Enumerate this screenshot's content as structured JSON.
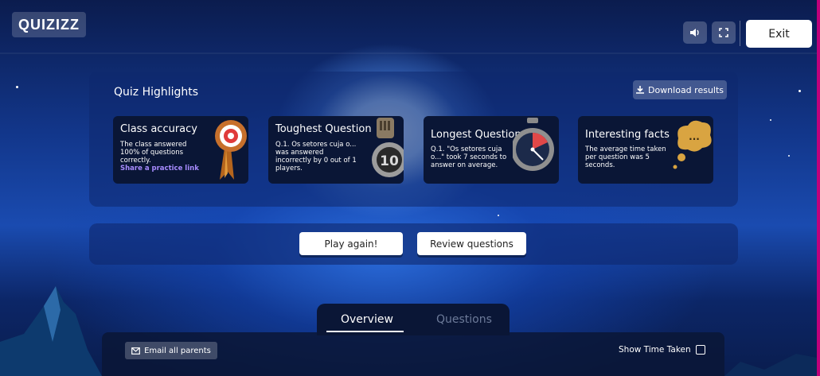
{
  "app": {
    "logo": "QUIZIZZ",
    "exit_label": "Exit"
  },
  "icons": {
    "sound": "speaker-icon",
    "fullscreen": "fullscreen-icon",
    "download": "download-icon",
    "email": "mail-icon"
  },
  "highlights": {
    "title": "Quiz Highlights",
    "download_label": "Download results",
    "cards": [
      {
        "title": "Class accuracy",
        "body": "The class answered 100% of questions correctly.",
        "link": "Share a practice link"
      },
      {
        "title": "Toughest Question",
        "body": "Q.1. Os setores cuja o... was answered incorrectly by 0 out of 1 players.",
        "badge": "10"
      },
      {
        "title": "Longest Question",
        "body": "Q.1. \"Os setores cuja o...\" took 7 seconds to answer on average."
      },
      {
        "title": "Interesting facts",
        "body": "The average time taken per question was 5 seconds.",
        "bubble": "..."
      }
    ]
  },
  "actions": {
    "play_again": "Play again!",
    "review": "Review questions"
  },
  "tabs": {
    "overview": "Overview",
    "questions": "Questions"
  },
  "bottom": {
    "email_label": "Email all parents",
    "show_time_label": "Show Time Taken"
  },
  "colors": {
    "link": "#a78bff",
    "accent_edge": "#c0007a",
    "card_bg": "#0a1636"
  }
}
